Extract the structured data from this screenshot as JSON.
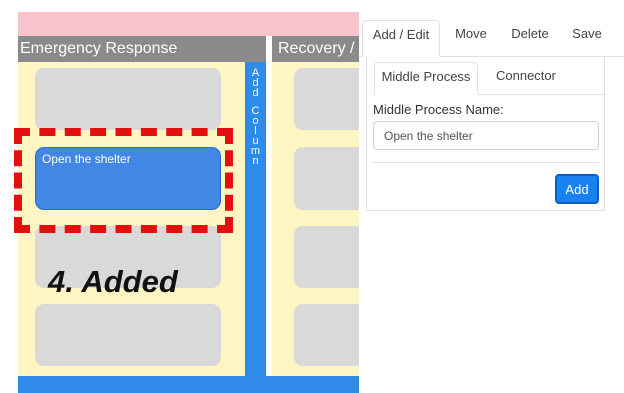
{
  "board": {
    "columns": [
      {
        "title": "Emergency Response"
      },
      {
        "title": "Recovery /"
      }
    ],
    "add_column_letters": [
      "A",
      "d",
      "d",
      "",
      "C",
      "o",
      "l",
      "u",
      "m",
      "n"
    ],
    "new_card": {
      "text": "Open the shelter"
    },
    "annotation": "4. Added"
  },
  "panel": {
    "tabs": [
      "Add / Edit",
      "Move",
      "Delete",
      "Save"
    ],
    "active_tab": "Add / Edit",
    "subtabs": [
      "Middle Process",
      "Connector"
    ],
    "active_subtab": "Middle Process",
    "field_label": "Middle Process Name:",
    "field_value": "Open the shelter",
    "add_button": "Add"
  },
  "colors": {
    "topbar": "#f9c3cd",
    "column_header": "#8a8a8a",
    "column_body": "#fdf6c2",
    "accent_blue": "#2f8ae8",
    "card_grey": "#d9d9d9",
    "card_blue": "#4287e6",
    "highlight_red": "#e31010"
  }
}
